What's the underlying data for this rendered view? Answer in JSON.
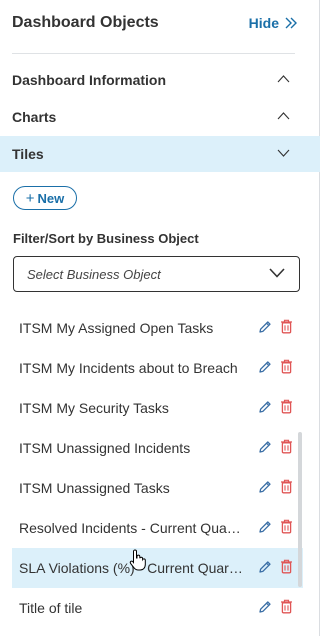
{
  "header": {
    "title": "Dashboard Objects",
    "hide_label": "Hide"
  },
  "sections": [
    {
      "label": "Dashboard Information",
      "state": "expanded"
    },
    {
      "label": "Charts",
      "state": "expanded"
    },
    {
      "label": "Tiles",
      "state": "collapsed",
      "active": true
    }
  ],
  "new_button": {
    "label": "New",
    "icon": "plus-icon"
  },
  "filter": {
    "label": "Filter/Sort by Business Object",
    "placeholder": "Select Business Object"
  },
  "tiles": [
    {
      "name": "ITSM My Assigned Open Tasks"
    },
    {
      "name": "ITSM My Incidents about to Breach"
    },
    {
      "name": "ITSM My Security Tasks"
    },
    {
      "name": "ITSM Unassigned Incidents"
    },
    {
      "name": "ITSM Unassigned Tasks"
    },
    {
      "name": "Resolved Incidents - Current Quarter"
    },
    {
      "name": "SLA Violations (%) - Current Quarter"
    },
    {
      "name": "Title of tile"
    }
  ],
  "colors": {
    "accent": "#1a6fa8",
    "active_bg": "#dcf0fa",
    "edit": "#3a6ea5",
    "delete": "#e05555"
  }
}
